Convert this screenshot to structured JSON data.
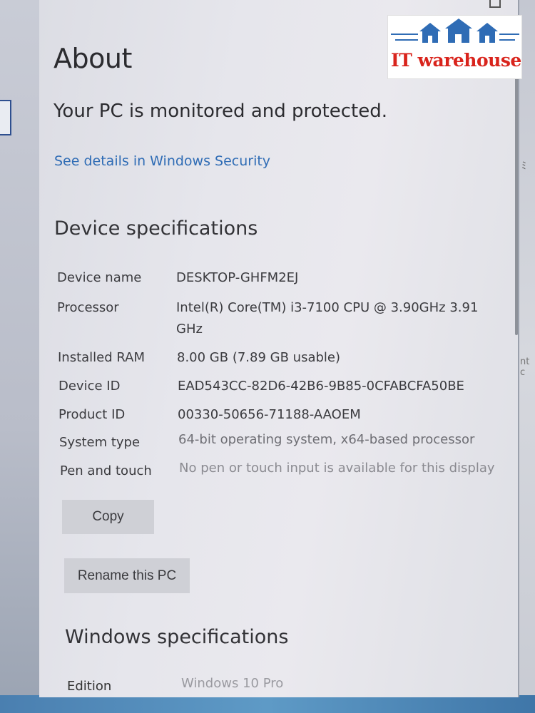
{
  "about": {
    "title": "About",
    "protection_message": "Your PC is monitored and protected.",
    "security_link": "See details in Windows Security"
  },
  "device_specifications": {
    "title": "Device specifications",
    "rows": [
      {
        "label": "Device name",
        "value": "DESKTOP-GHFM2EJ"
      },
      {
        "label": "Processor",
        "value": "Intel(R) Core(TM) i3-7100 CPU @ 3.90GHz   3.91 GHz"
      },
      {
        "label": "Installed RAM",
        "value": "8.00 GB (7.89 GB usable)"
      },
      {
        "label": "Device ID",
        "value": "EAD543CC-82D6-42B6-9B85-0CFABCFA50BE"
      },
      {
        "label": "Product ID",
        "value": "00330-50656-71188-AAOEM"
      },
      {
        "label": "System type",
        "value": "64-bit operating system, x64-based processor"
      },
      {
        "label": "Pen and touch",
        "value": "No pen or touch input is available for this display"
      }
    ],
    "copy_label": "Copy",
    "rename_label": "Rename this PC"
  },
  "windows_specifications": {
    "title": "Windows specifications",
    "edition_label": "Edition",
    "edition_value": "Windows 10 Pro"
  },
  "watermark": {
    "text": "IT warehouse",
    "color": "#d9241c",
    "accent": "#2f6cb5"
  },
  "window_controls": {
    "maximize_icon": "maximize-icon",
    "close_icon": "close-icon",
    "close_glyph": "✕"
  },
  "background_fragments": {
    "right_edge_text": "nt c",
    "right_edge_mark": "ﾐ"
  }
}
